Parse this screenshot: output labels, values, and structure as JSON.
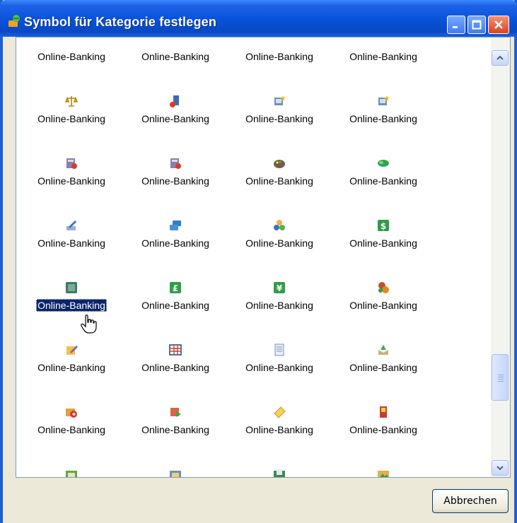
{
  "window": {
    "title": "Symbol für Kategorie festlegen"
  },
  "list": {
    "selected_index": 16,
    "item_label": "Online-Banking",
    "rows": [
      [
        {
          "label": "Online-Banking",
          "icon": "none"
        },
        {
          "label": "Online-Banking",
          "icon": "none"
        },
        {
          "label": "Online-Banking",
          "icon": "none"
        },
        {
          "label": "Online-Banking",
          "icon": "none"
        }
      ],
      [
        {
          "label": "Online-Banking",
          "icon": "scales-icon"
        },
        {
          "label": "Online-Banking",
          "icon": "server-coins-icon"
        },
        {
          "label": "Online-Banking",
          "icon": "computer-star-icon"
        },
        {
          "label": "Online-Banking",
          "icon": "computer-star-icon"
        }
      ],
      [
        {
          "label": "Online-Banking",
          "icon": "calculator-icon"
        },
        {
          "label": "Online-Banking",
          "icon": "calculator-icon"
        },
        {
          "label": "Online-Banking",
          "icon": "palette-icon"
        },
        {
          "label": "Online-Banking",
          "icon": "money-roll-icon"
        }
      ],
      [
        {
          "label": "Online-Banking",
          "icon": "pen-write-icon"
        },
        {
          "label": "Online-Banking",
          "icon": "cards-icon"
        },
        {
          "label": "Online-Banking",
          "icon": "people-icon"
        },
        {
          "label": "Online-Banking",
          "icon": "dollar-icon"
        }
      ],
      [
        {
          "label": "Online-Banking",
          "icon": "chip-icon"
        },
        {
          "label": "Online-Banking",
          "icon": "pound-icon"
        },
        {
          "label": "Online-Banking",
          "icon": "yen-icon"
        },
        {
          "label": "Online-Banking",
          "icon": "coins-icon"
        }
      ],
      [
        {
          "label": "Online-Banking",
          "icon": "edit-note-icon"
        },
        {
          "label": "Online-Banking",
          "icon": "table-icon"
        },
        {
          "label": "Online-Banking",
          "icon": "document-icon"
        },
        {
          "label": "Online-Banking",
          "icon": "open-box-icon"
        }
      ],
      [
        {
          "label": "Online-Banking",
          "icon": "mail-arrow-icon"
        },
        {
          "label": "Online-Banking",
          "icon": "mail-go-icon"
        },
        {
          "label": "Online-Banking",
          "icon": "tag-icon"
        },
        {
          "label": "Online-Banking",
          "icon": "book-icon"
        }
      ],
      [
        {
          "label": "",
          "icon": "folder-green-icon"
        },
        {
          "label": "",
          "icon": "folder-note-icon"
        },
        {
          "label": "",
          "icon": "folder-cash-icon"
        },
        {
          "label": "",
          "icon": "folder-image-icon"
        }
      ]
    ]
  },
  "buttons": {
    "cancel": "Abbrechen"
  },
  "colors": {
    "title_bar": "#0a53dd",
    "selection": "#0a246a",
    "dialog_bg": "#ece9d8"
  }
}
